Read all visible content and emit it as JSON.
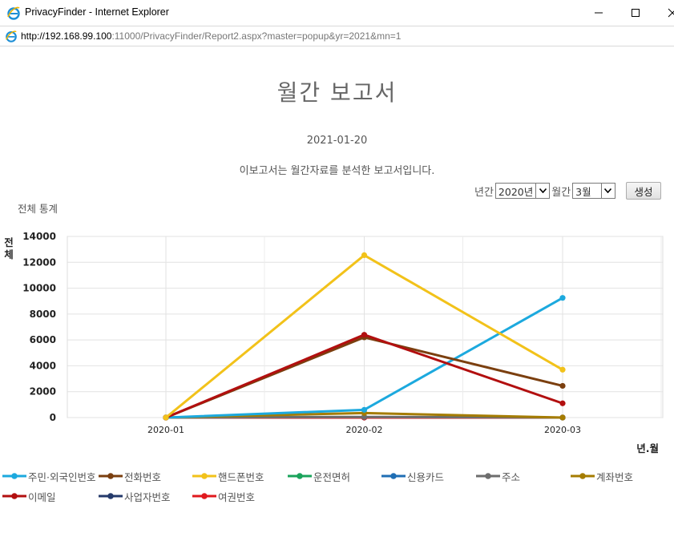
{
  "window": {
    "title": "PrivacyFinder - Internet Explorer",
    "url_host": "http://192.168.99.100",
    "url_rest": ":11000/PrivacyFinder/Report2.aspx?master=popup&yr=2021&mn=1"
  },
  "page": {
    "title": "월간 보고서",
    "date": "2021-01-20",
    "description": "이보고서는 월간자료를 분석한 보고서입니다.",
    "section_label": "전체 통계"
  },
  "controls": {
    "year_label": "년간",
    "year_value": "2020년",
    "month_label": "월간",
    "month_value": "3월",
    "generate_label": "생성"
  },
  "chart_data": {
    "type": "line",
    "ylabel": "전체",
    "xlabel": "년.월",
    "ylim": [
      0,
      14000
    ],
    "yticks": [
      0,
      2000,
      4000,
      6000,
      8000,
      10000,
      12000,
      14000
    ],
    "categories": [
      "2020-01",
      "2020-02",
      "2020-03"
    ],
    "grid": true,
    "legend_position": "bottom",
    "series": [
      {
        "name": "주민·외국인번호",
        "color": "#1ca9de",
        "values": [
          0,
          600,
          9250
        ]
      },
      {
        "name": "전화번호",
        "color": "#7b3f0f",
        "values": [
          0,
          6200,
          2450
        ]
      },
      {
        "name": "핸드폰번호",
        "color": "#f2c21a",
        "values": [
          0,
          12550,
          3700
        ]
      },
      {
        "name": "운전면허",
        "color": "#1aa35b",
        "values": [
          0,
          0,
          0
        ]
      },
      {
        "name": "신용카드",
        "color": "#1f6eb4",
        "values": [
          0,
          0,
          0
        ]
      },
      {
        "name": "주소",
        "color": "#6d6d6d",
        "values": [
          0,
          50,
          0
        ]
      },
      {
        "name": "계좌번호",
        "color": "#a57c00",
        "values": [
          0,
          350,
          0
        ]
      },
      {
        "name": "이메일",
        "color": "#b20f0f",
        "values": [
          0,
          6400,
          1100
        ]
      },
      {
        "name": "사업자번호",
        "color": "#243a6b",
        "values": [
          0,
          0,
          0
        ]
      },
      {
        "name": "여권번호",
        "color": "#e0191e",
        "values": [
          0,
          0,
          0
        ]
      }
    ]
  }
}
